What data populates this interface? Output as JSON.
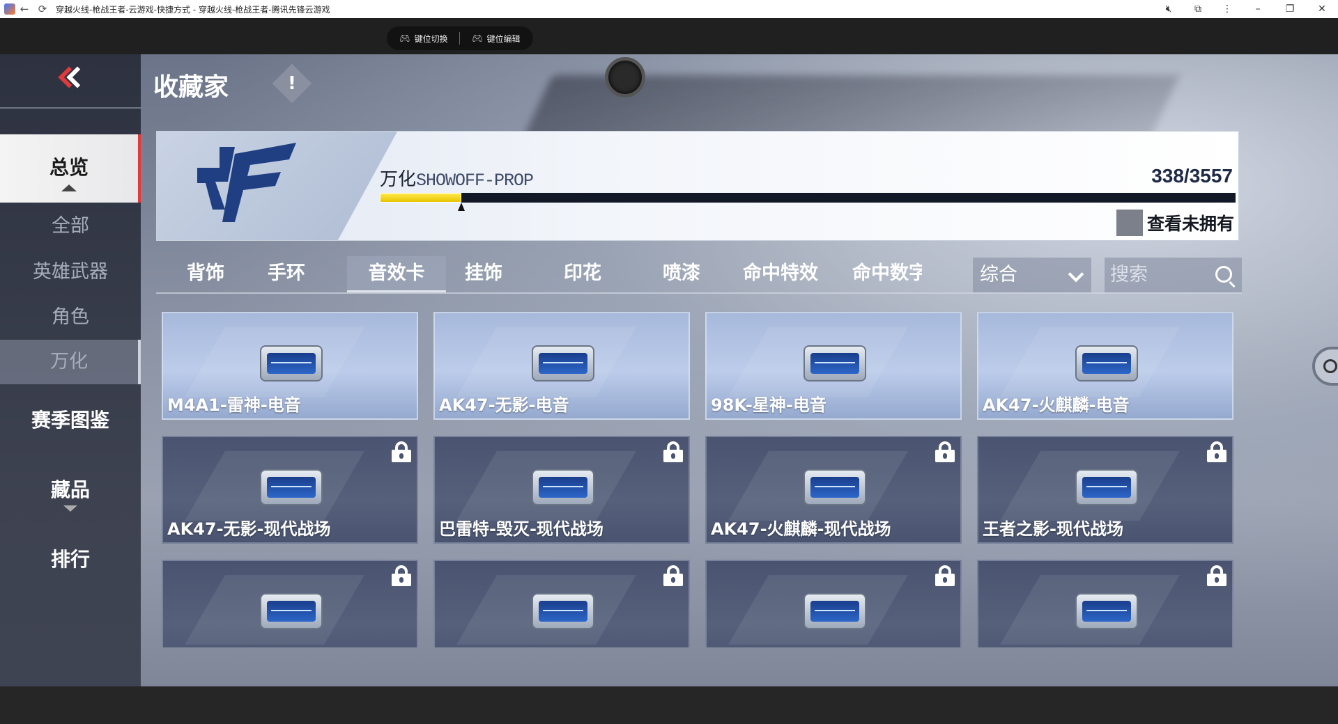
{
  "window": {
    "title": "穿越火线-枪战王者-云游戏-快捷方式 - 穿越火线-枪战王者-腾讯先锋云游戏",
    "controls": [
      "back-icon",
      "refresh-icon",
      "mute-icon",
      "extension-icon",
      "more-icon",
      "minimize-icon",
      "restore-icon",
      "close-icon"
    ]
  },
  "toolbar": {
    "key_switch_label": "键位切换",
    "key_edit_label": "键位编辑"
  },
  "page": {
    "title": "收藏家",
    "info_symbol": "!"
  },
  "sidebar": {
    "overview": "总览",
    "all": "全部",
    "hero_weapons": "英雄武器",
    "role": "角色",
    "wanhua": "万化",
    "season_atlas": "赛季图鉴",
    "collectibles": "藏品",
    "ranking": "排行"
  },
  "banner": {
    "name_cn": "万化",
    "name_en": "SHOWOFF-PROP",
    "owned": 338,
    "total": 3557,
    "count_text": "338/3557",
    "progress": 0.095,
    "unowned_label": "查看未拥有",
    "unowned_checked": false
  },
  "tabs": [
    {
      "label": "背饰",
      "active": false
    },
    {
      "label": "手环",
      "active": false
    },
    {
      "label": "音效卡",
      "active": true
    },
    {
      "label": "挂饰",
      "active": false
    },
    {
      "label": "印花",
      "active": false
    },
    {
      "label": "喷漆",
      "active": false
    },
    {
      "label": "命中特效",
      "active": false
    },
    {
      "label": "命中数字",
      "active": false
    }
  ],
  "sort": {
    "value": "综合"
  },
  "search": {
    "placeholder": "搜索"
  },
  "items": [
    {
      "label": "M4A1-雷神-电音",
      "locked": false
    },
    {
      "label": "AK47-无影-电音",
      "locked": false
    },
    {
      "label": "98K-星神-电音",
      "locked": false
    },
    {
      "label": "AK47-火麒麟-电音",
      "locked": false
    },
    {
      "label": "AK47-无影-现代战场",
      "locked": true
    },
    {
      "label": "巴雷特-毁灭-现代战场",
      "locked": true
    },
    {
      "label": "AK47-火麒麟-现代战场",
      "locked": true
    },
    {
      "label": "王者之影-现代战场",
      "locked": true
    },
    {
      "label": "",
      "locked": true
    },
    {
      "label": "",
      "locked": true
    },
    {
      "label": "",
      "locked": true
    },
    {
      "label": "",
      "locked": true
    }
  ],
  "colors": {
    "accent_red": "#e03a3a",
    "progress_yellow": "#ffe94a",
    "owned_card": "#a7b9db",
    "locked_card": "#4a5470"
  }
}
